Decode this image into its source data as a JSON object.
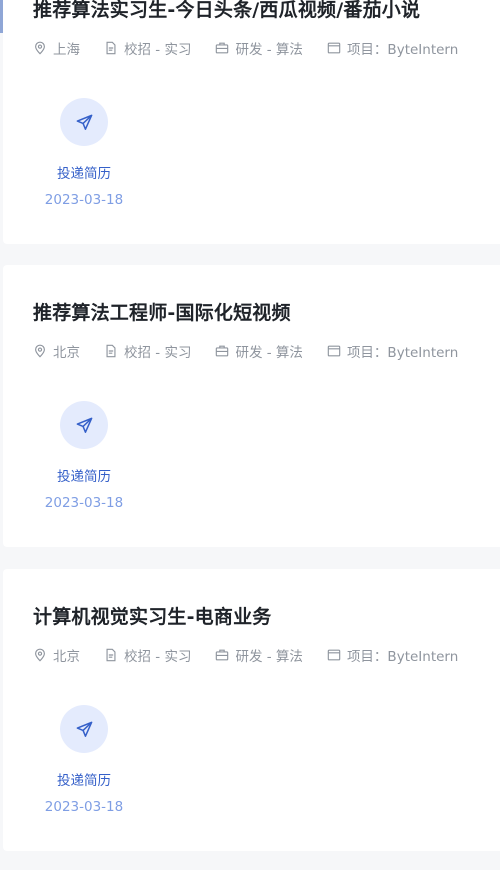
{
  "colors": {
    "title": "#1f2329",
    "meta": "#8f959e",
    "apply_bg": "#e4ebfd",
    "apply_icon": "#3560c9",
    "apply_label": "#3560c9",
    "date": "#7f9ee4",
    "accent": "#8fa6d6"
  },
  "icons": {
    "location": "location-pin-icon",
    "type": "document-icon",
    "category": "briefcase-icon",
    "project": "window-icon",
    "apply": "paper-plane-icon"
  },
  "jobs": [
    {
      "title": "推荐算法实习生-今日头条/西瓜视频/番茄小说",
      "location": "上海",
      "type": "校招 - 实习",
      "category": "研发 - 算法",
      "project": "项目：ByteIntern",
      "apply_label": "投递简历",
      "date": "2023-03-18"
    },
    {
      "title": "推荐算法工程师-国际化短视频",
      "location": "北京",
      "type": "校招 - 实习",
      "category": "研发 - 算法",
      "project": "项目：ByteIntern",
      "apply_label": "投递简历",
      "date": "2023-03-18"
    },
    {
      "title": "计算机视觉实习生-电商业务",
      "location": "北京",
      "type": "校招 - 实习",
      "category": "研发 - 算法",
      "project": "项目：ByteIntern",
      "apply_label": "投递简历",
      "date": "2023-03-18"
    }
  ]
}
